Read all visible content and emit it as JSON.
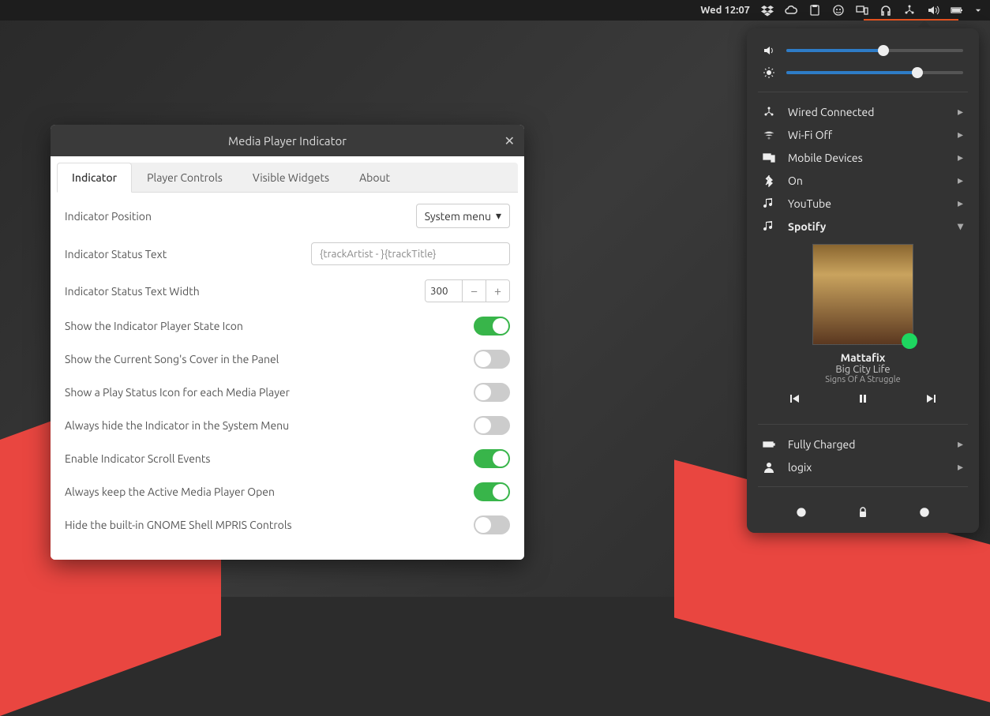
{
  "topbar": {
    "clock": "Wed 12:07"
  },
  "sysmenu": {
    "volume": 55,
    "brightness": 74,
    "items": [
      {
        "icon": "ethernet",
        "label": "Wired Connected"
      },
      {
        "icon": "wifi-off",
        "label": "Wi-Fi Off"
      },
      {
        "icon": "mobile",
        "label": "Mobile Devices"
      },
      {
        "icon": "bluetooth",
        "label": "On"
      },
      {
        "icon": "music",
        "label": "YouTube"
      },
      {
        "icon": "music",
        "label": "Spotify",
        "active": true
      }
    ],
    "player": {
      "artist": "Mattafix",
      "title": "Big City Life",
      "album": "Signs Of A Struggle"
    },
    "battery": "Fully Charged",
    "user": "logix"
  },
  "window": {
    "title": "Media Player Indicator",
    "tabs": [
      "Indicator",
      "Player Controls",
      "Visible Widgets",
      "About"
    ],
    "activeTab": 0,
    "form": {
      "position": {
        "label": "Indicator Position",
        "value": "System menu"
      },
      "statusText": {
        "label": "Indicator Status Text",
        "value": "{trackArtist - }{trackTitle}"
      },
      "statusWidth": {
        "label": "Indicator Status Text Width",
        "value": "300"
      },
      "toggles": [
        {
          "label": "Show the Indicator Player State Icon",
          "on": true
        },
        {
          "label": "Show the Current Song's Cover in the Panel",
          "on": false
        },
        {
          "label": "Show a Play Status Icon for each Media Player",
          "on": false
        },
        {
          "label": "Always hide the Indicator in the System Menu",
          "on": false
        },
        {
          "label": "Enable Indicator Scroll Events",
          "on": true
        },
        {
          "label": "Always keep the Active Media Player Open",
          "on": true
        },
        {
          "label": "Hide the built-in GNOME Shell MPRIS Controls",
          "on": false
        }
      ]
    }
  }
}
